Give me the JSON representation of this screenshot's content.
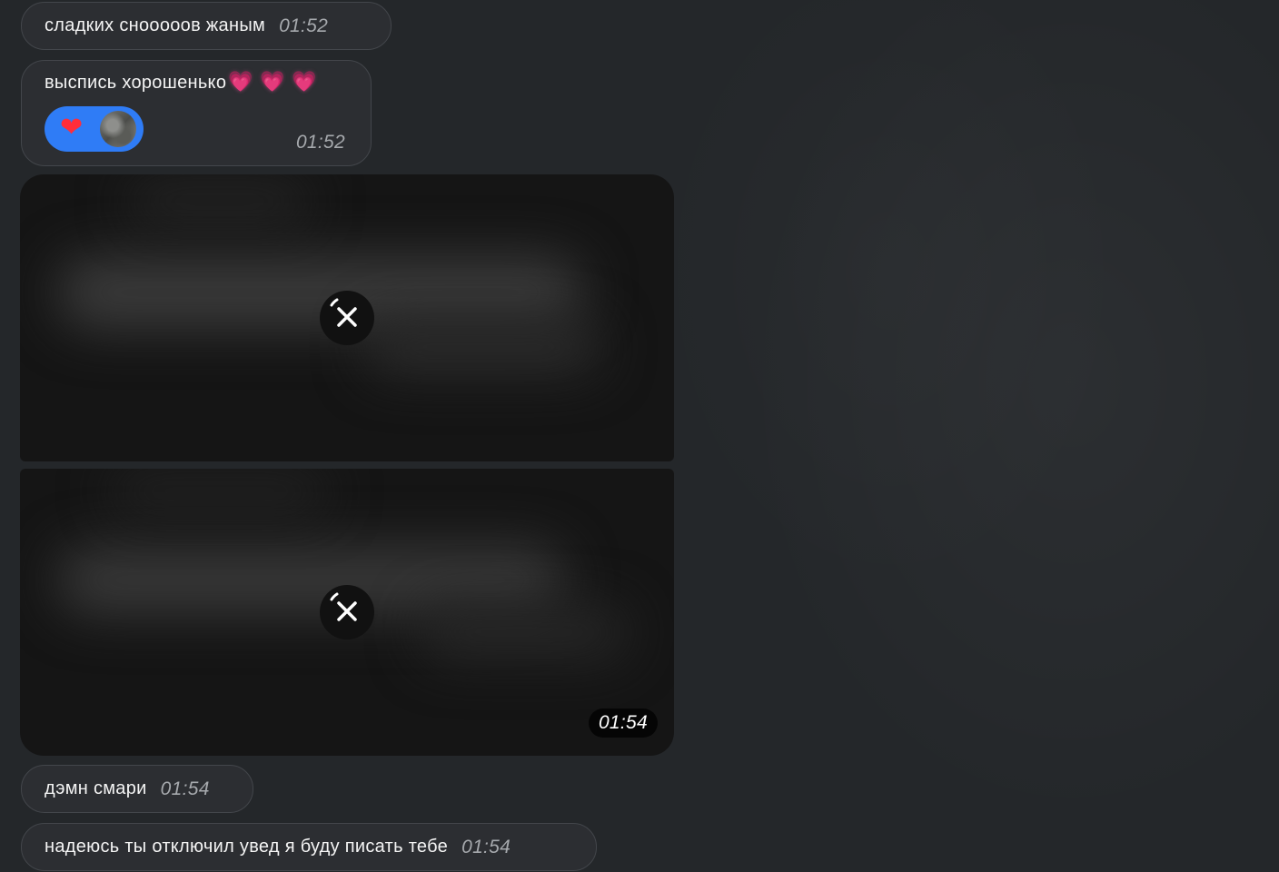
{
  "messages": [
    {
      "text": "сладких сноооoов жаным",
      "time": "01:52"
    },
    {
      "text": "выспись хорошенько",
      "emoji": "💗 💗 💗",
      "time": "01:52",
      "reaction": {
        "icon": "heart-icon",
        "emoji": "❤"
      }
    },
    {
      "type": "media",
      "status": "loading",
      "icon": "close-icon"
    },
    {
      "type": "media",
      "status": "loading",
      "icon": "close-icon",
      "time": "01:54"
    },
    {
      "text": "дэмн смари",
      "time": "01:54"
    },
    {
      "text": "надеюсь ты отключил увед я буду писать тебе",
      "time": "01:54"
    }
  ],
  "colors": {
    "background": "#24272a",
    "bubble": "#2c2e32",
    "reaction_pill": "#2f7cf6",
    "time_text": "#a6a9ad"
  }
}
